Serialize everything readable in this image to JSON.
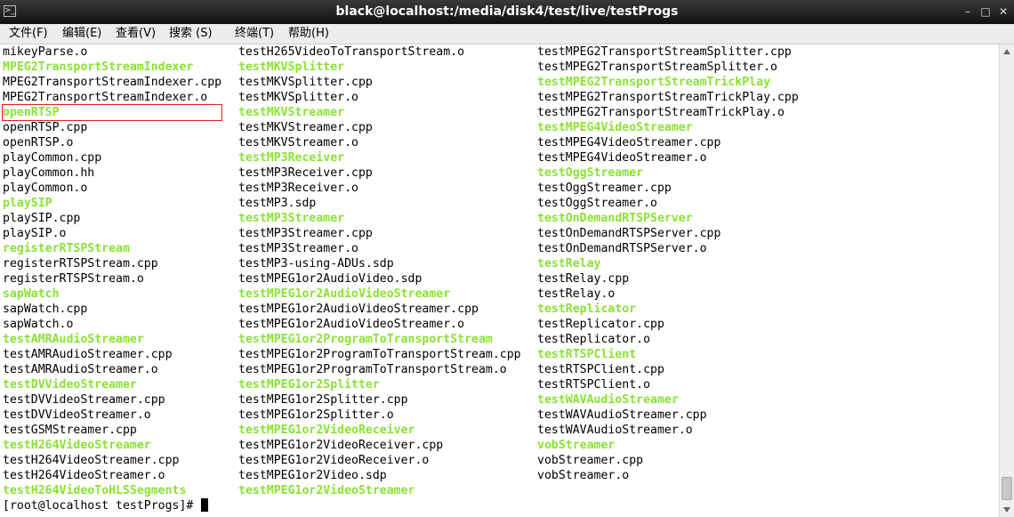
{
  "window": {
    "title": "black@localhost:/media/disk4/test/live/testProgs",
    "icon": "terminal-icon",
    "controls": {
      "minimize": "–",
      "maximize": "□",
      "close": "✕"
    }
  },
  "menu": [
    "文件(F)",
    "编辑(E)",
    "查看(V)",
    "搜索 (S)",
    "终端(T)",
    "帮助(H)"
  ],
  "columns": [
    [
      {
        "text": "mikeyParse.o",
        "exec": false
      },
      {
        "text": "MPEG2TransportStreamIndexer",
        "exec": true
      },
      {
        "text": "MPEG2TransportStreamIndexer.cpp",
        "exec": false
      },
      {
        "text": "MPEG2TransportStreamIndexer.o",
        "exec": false
      },
      {
        "text": "openRTSP",
        "exec": true,
        "selected": true
      },
      {
        "text": "openRTSP.cpp",
        "exec": false
      },
      {
        "text": "openRTSP.o",
        "exec": false
      },
      {
        "text": "playCommon.cpp",
        "exec": false
      },
      {
        "text": "playCommon.hh",
        "exec": false
      },
      {
        "text": "playCommon.o",
        "exec": false
      },
      {
        "text": "playSIP",
        "exec": true
      },
      {
        "text": "playSIP.cpp",
        "exec": false
      },
      {
        "text": "playSIP.o",
        "exec": false
      },
      {
        "text": "registerRTSPStream",
        "exec": true
      },
      {
        "text": "registerRTSPStream.cpp",
        "exec": false
      },
      {
        "text": "registerRTSPStream.o",
        "exec": false
      },
      {
        "text": "sapWatch",
        "exec": true
      },
      {
        "text": "sapWatch.cpp",
        "exec": false
      },
      {
        "text": "sapWatch.o",
        "exec": false
      },
      {
        "text": "testAMRAudioStreamer",
        "exec": true
      },
      {
        "text": "testAMRAudioStreamer.cpp",
        "exec": false
      },
      {
        "text": "testAMRAudioStreamer.o",
        "exec": false
      },
      {
        "text": "testDVVideoStreamer",
        "exec": true
      },
      {
        "text": "testDVVideoStreamer.cpp",
        "exec": false
      },
      {
        "text": "testDVVideoStreamer.o",
        "exec": false
      },
      {
        "text": "testGSMStreamer.cpp",
        "exec": false
      },
      {
        "text": "testH264VideoStreamer",
        "exec": true
      },
      {
        "text": "testH264VideoStreamer.cpp",
        "exec": false
      },
      {
        "text": "testH264VideoStreamer.o",
        "exec": false
      },
      {
        "text": "testH264VideoToHLSSegments",
        "exec": true
      }
    ],
    [
      {
        "text": "testH265VideoToTransportStream.o",
        "exec": false
      },
      {
        "text": "testMKVSplitter",
        "exec": true
      },
      {
        "text": "testMKVSplitter.cpp",
        "exec": false
      },
      {
        "text": "testMKVSplitter.o",
        "exec": false
      },
      {
        "text": "testMKVStreamer",
        "exec": true
      },
      {
        "text": "testMKVStreamer.cpp",
        "exec": false
      },
      {
        "text": "testMKVStreamer.o",
        "exec": false
      },
      {
        "text": "testMP3Receiver",
        "exec": true
      },
      {
        "text": "testMP3Receiver.cpp",
        "exec": false
      },
      {
        "text": "testMP3Receiver.o",
        "exec": false
      },
      {
        "text": "testMP3.sdp",
        "exec": false
      },
      {
        "text": "testMP3Streamer",
        "exec": true
      },
      {
        "text": "testMP3Streamer.cpp",
        "exec": false
      },
      {
        "text": "testMP3Streamer.o",
        "exec": false
      },
      {
        "text": "testMP3-using-ADUs.sdp",
        "exec": false
      },
      {
        "text": "testMPEG1or2AudioVideo.sdp",
        "exec": false
      },
      {
        "text": "testMPEG1or2AudioVideoStreamer",
        "exec": true
      },
      {
        "text": "testMPEG1or2AudioVideoStreamer.cpp",
        "exec": false
      },
      {
        "text": "testMPEG1or2AudioVideoStreamer.o",
        "exec": false
      },
      {
        "text": "testMPEG1or2ProgramToTransportStream",
        "exec": true
      },
      {
        "text": "testMPEG1or2ProgramToTransportStream.cpp",
        "exec": false
      },
      {
        "text": "testMPEG1or2ProgramToTransportStream.o",
        "exec": false
      },
      {
        "text": "testMPEG1or2Splitter",
        "exec": true
      },
      {
        "text": "testMPEG1or2Splitter.cpp",
        "exec": false
      },
      {
        "text": "testMPEG1or2Splitter.o",
        "exec": false
      },
      {
        "text": "testMPEG1or2VideoReceiver",
        "exec": true
      },
      {
        "text": "testMPEG1or2VideoReceiver.cpp",
        "exec": false
      },
      {
        "text": "testMPEG1or2VideoReceiver.o",
        "exec": false
      },
      {
        "text": "testMPEG1or2Video.sdp",
        "exec": false
      },
      {
        "text": "testMPEG1or2VideoStreamer",
        "exec": true
      }
    ],
    [
      {
        "text": "testMPEG2TransportStreamSplitter.cpp",
        "exec": false
      },
      {
        "text": "testMPEG2TransportStreamSplitter.o",
        "exec": false
      },
      {
        "text": "testMPEG2TransportStreamTrickPlay",
        "exec": true
      },
      {
        "text": "testMPEG2TransportStreamTrickPlay.cpp",
        "exec": false
      },
      {
        "text": "testMPEG2TransportStreamTrickPlay.o",
        "exec": false
      },
      {
        "text": "testMPEG4VideoStreamer",
        "exec": true
      },
      {
        "text": "testMPEG4VideoStreamer.cpp",
        "exec": false
      },
      {
        "text": "testMPEG4VideoStreamer.o",
        "exec": false
      },
      {
        "text": "testOggStreamer",
        "exec": true
      },
      {
        "text": "testOggStreamer.cpp",
        "exec": false
      },
      {
        "text": "testOggStreamer.o",
        "exec": false
      },
      {
        "text": "testOnDemandRTSPServer",
        "exec": true
      },
      {
        "text": "testOnDemandRTSPServer.cpp",
        "exec": false
      },
      {
        "text": "testOnDemandRTSPServer.o",
        "exec": false
      },
      {
        "text": "testRelay",
        "exec": true
      },
      {
        "text": "testRelay.cpp",
        "exec": false
      },
      {
        "text": "testRelay.o",
        "exec": false
      },
      {
        "text": "testReplicator",
        "exec": true
      },
      {
        "text": "testReplicator.cpp",
        "exec": false
      },
      {
        "text": "testReplicator.o",
        "exec": false
      },
      {
        "text": "testRTSPClient",
        "exec": true
      },
      {
        "text": "testRTSPClient.cpp",
        "exec": false
      },
      {
        "text": "testRTSPClient.o",
        "exec": false
      },
      {
        "text": "testWAVAudioStreamer",
        "exec": true
      },
      {
        "text": "testWAVAudioStreamer.cpp",
        "exec": false
      },
      {
        "text": "testWAVAudioStreamer.o",
        "exec": false
      },
      {
        "text": "vobStreamer",
        "exec": true
      },
      {
        "text": "vobStreamer.cpp",
        "exec": false
      },
      {
        "text": "vobStreamer.o",
        "exec": false
      }
    ]
  ],
  "prompt": "[root@localhost testProgs]# ",
  "colors": {
    "executable": "#8ae234",
    "regular": "#000000",
    "selection_box": "#e02020"
  }
}
